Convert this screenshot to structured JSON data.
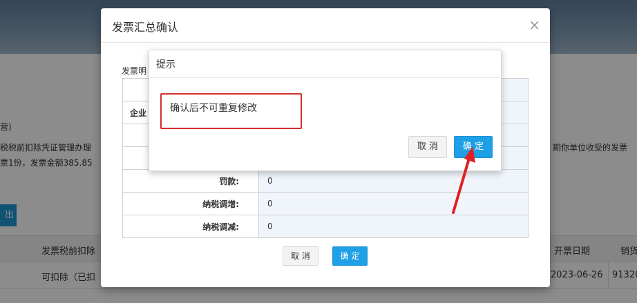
{
  "background": {
    "text_line1": "营)",
    "text_line2": "税税前扣除凭证管理办理",
    "text_line3": "票1份，发票金额385.85",
    "text_right": "期你单位收受的发票",
    "export_btn": "出",
    "table_headers": [
      "发票税前扣除",
      "开票日期",
      "销货"
    ],
    "row_values": [
      "可扣除（已扣",
      "2023-06-26",
      "91320"
    ]
  },
  "modal": {
    "title": "发票汇总确认",
    "close_label": "×",
    "section_label": "发票明",
    "rows": [
      {
        "label": "",
        "value": ""
      },
      {
        "label": "企业",
        "value": ""
      },
      {
        "label": "",
        "value": ""
      },
      {
        "label": "",
        "value": ""
      },
      {
        "label": "罚款:",
        "value": "0"
      },
      {
        "label": "纳税调增:",
        "value": "0"
      },
      {
        "label": "纳税调减:",
        "value": "0"
      }
    ],
    "cancel_label": "取 消",
    "confirm_label": "确 定"
  },
  "popup": {
    "title": "提示",
    "message": "确认后不可重复修改",
    "cancel_label": "取 消",
    "confirm_label": "确 定"
  },
  "colors": {
    "primary": "#1fa0e6",
    "highlight": "#d32f2f"
  }
}
